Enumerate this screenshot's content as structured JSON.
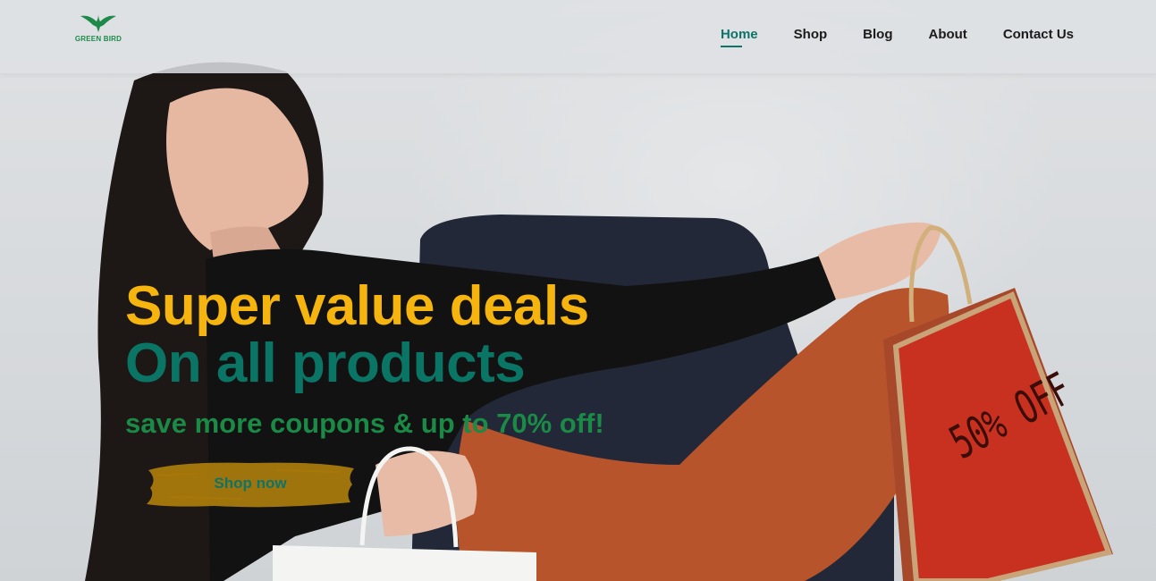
{
  "brand": {
    "name": "GREEN BIRD",
    "color": "#1e8a4a"
  },
  "nav": {
    "items": [
      {
        "label": "Home",
        "active": true
      },
      {
        "label": "Shop",
        "active": false
      },
      {
        "label": "Blog",
        "active": false
      },
      {
        "label": "About",
        "active": false
      },
      {
        "label": "Contact Us",
        "active": false
      }
    ],
    "active_color": "#0d7468"
  },
  "hero": {
    "headline_1": "Super value deals",
    "headline_2": "On all products",
    "subline": "save more coupons & up to 70% off!",
    "cta_label": "Shop now",
    "bag_text": "50% OFF",
    "colors": {
      "headline_1": "#f6b40e",
      "headline_2": "#0a7465",
      "subline": "#1a8a46",
      "cta_brush": "#c8900a"
    }
  }
}
